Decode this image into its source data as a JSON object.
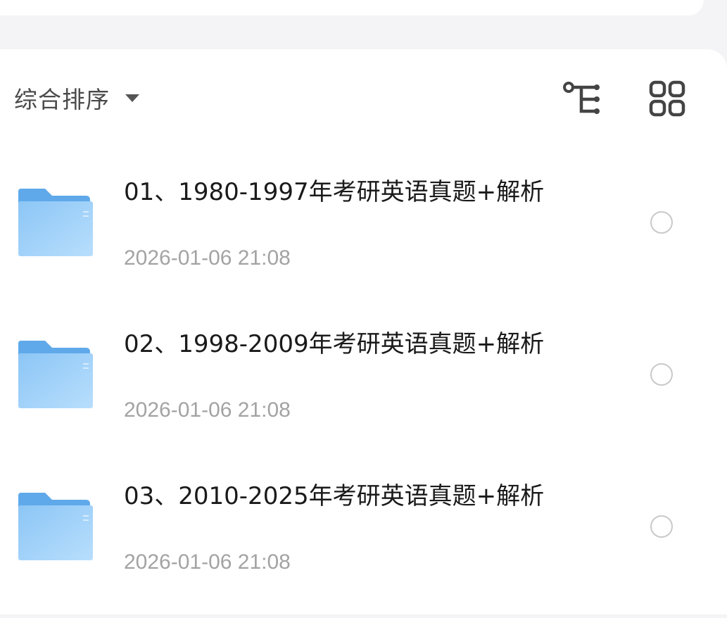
{
  "toolbar": {
    "sort_label": "综合排序",
    "sort_icon": "caret-down-icon",
    "tree_view_icon": "tree-view-icon",
    "grid_view_icon": "grid-view-icon"
  },
  "files": [
    {
      "name": "01、1980-1997年考研英语真题+解析",
      "date": "2026-01-06 21:08",
      "type_icon": "folder-icon"
    },
    {
      "name": "02、1998-2009年考研英语真题+解析",
      "date": "2026-01-06 21:08",
      "type_icon": "folder-icon"
    },
    {
      "name": "03、2010-2025年考研英语真题+解析",
      "date": "2026-01-06 21:08",
      "type_icon": "folder-icon"
    }
  ],
  "colors": {
    "folder_light": "#a9d6fb",
    "folder_dark": "#6fb4ef",
    "date_text": "#a3a3a3",
    "radio_border": "#c9c9c9"
  }
}
